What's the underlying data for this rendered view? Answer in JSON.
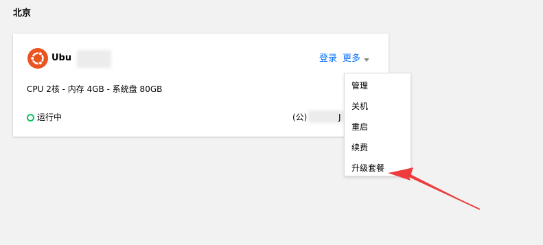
{
  "region": {
    "title": "北京"
  },
  "instance": {
    "os_icon": "ubuntu-logo",
    "name_visible": "Ubu",
    "specs": "CPU 2核 - 内存 4GB - 系统盘 80GB",
    "status": "运行中",
    "ip_prefix": "(公)",
    "ip_suffix": "J",
    "actions": {
      "login": "登录",
      "more": "更多"
    }
  },
  "dropdown": {
    "items": [
      {
        "label": "管理"
      },
      {
        "label": "关机"
      },
      {
        "label": "重启"
      },
      {
        "label": "续费"
      },
      {
        "label": "升级套餐"
      }
    ]
  },
  "colors": {
    "accent": "#006eff",
    "status_running": "#0abf5b",
    "ubuntu_orange": "#e95420",
    "annotation_arrow": "#ee3b3b"
  }
}
